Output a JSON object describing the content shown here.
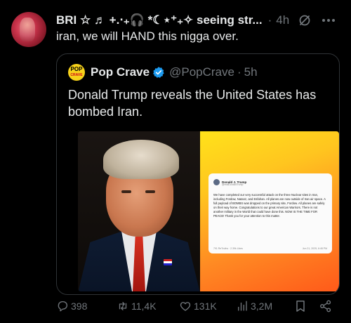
{
  "tweet": {
    "display_name": "BRI ☆ ♬ +.‧₊🎧 *☾⋆⁺₊✧ seeing str...",
    "sep": "·",
    "time": "4h",
    "text": "iran, we will HAND this nigga over."
  },
  "quoted": {
    "logo_line1": "POP",
    "logo_line2": "CRAVE",
    "name": "Pop Crave",
    "handle": "@PopCrave",
    "sep": "·",
    "time": "5h",
    "text": "Donald Trump reveals the United States has bombed Iran.",
    "embedded_post": {
      "name": "Donald J. Trump",
      "handle": "@realDonaldTrump",
      "body": "We have completed our very successful attack on the three Nuclear sites in Iran, including Fordow, Natanz, and Esfahan. All planes are now outside of Iran air space. A full payload of BOMBS was dropped on the primary site, Fordow. All planes are safely on their way home. Congratulations to our great American Warriors. There is not another military in the World that could have done this. NOW IS THE TIME FOR PEACE! Thank you for your attention to this matter.",
      "stats": "791 ReTruths · 2.39k Likes",
      "date": "Jun 21, 2025, 6:48 PM"
    }
  },
  "actions": {
    "replies": "398",
    "reposts": "11,4K",
    "likes": "131K",
    "views": "3,2M"
  },
  "colors": {
    "background": "#000000",
    "text": "#e7e9ea",
    "muted": "#71767b",
    "verified": "#1d9bf0",
    "border": "#2f3336"
  },
  "icons": [
    "grok-icon",
    "more-icon",
    "verified-icon",
    "reply-icon",
    "repost-icon",
    "like-icon",
    "views-icon",
    "bookmark-icon",
    "share-icon"
  ]
}
